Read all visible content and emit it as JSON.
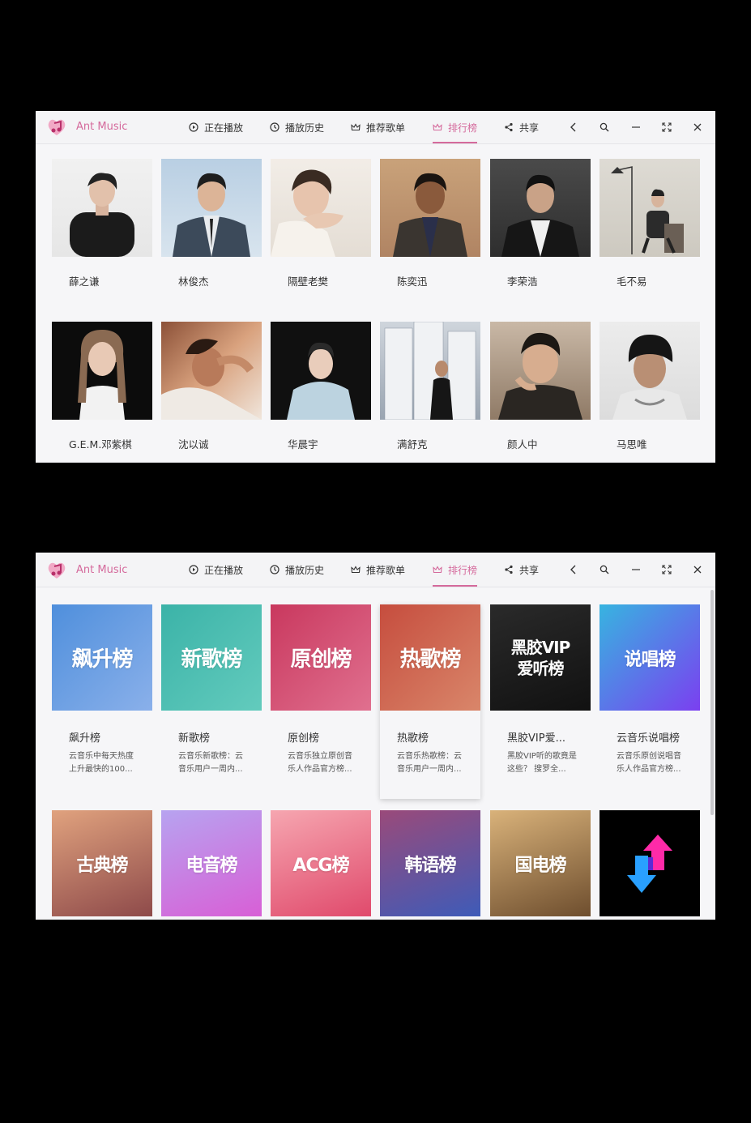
{
  "app": {
    "name": "Ant Music"
  },
  "nav": {
    "now_playing": "正在播放",
    "history": "播放历史",
    "recommended": "推荐歌单",
    "charts": "排行榜",
    "share": "共享"
  },
  "window_controls": [
    "back-icon",
    "search-icon",
    "minimize-icon",
    "maximize-icon",
    "close-icon"
  ],
  "colors": {
    "accent": "#d56a9c",
    "background": "#f6f6f8"
  },
  "artists": [
    {
      "name": "薛之谦"
    },
    {
      "name": "林俊杰"
    },
    {
      "name": "隔壁老樊"
    },
    {
      "name": "陈奕迅"
    },
    {
      "name": "李荣浩"
    },
    {
      "name": "毛不易"
    },
    {
      "name": "G.E.M.邓紫棋"
    },
    {
      "name": "沈以诚"
    },
    {
      "name": "华晨宇"
    },
    {
      "name": "满舒克"
    },
    {
      "name": "颜人中"
    },
    {
      "name": "马思唯"
    }
  ],
  "charts": [
    {
      "name": "飙升榜",
      "desc": "云音乐中每天热度上升最快的100...",
      "cover_text": "飙升榜"
    },
    {
      "name": "新歌榜",
      "desc": "云音乐新歌榜：云音乐用户一周内...",
      "cover_text": "新歌榜"
    },
    {
      "name": "原创榜",
      "desc": "云音乐独立原创音乐人作品官方榜...",
      "cover_text": "原创榜"
    },
    {
      "name": "热歌榜",
      "desc": "云音乐热歌榜：云音乐用户一周内...",
      "cover_text": "热歌榜"
    },
    {
      "name": "黑胶VIP爱...",
      "desc": "黑胶VIP听的歌竟是这些？ 搜罗全...",
      "cover_text": "黑胶VIP 爱听榜"
    },
    {
      "name": "云音乐说唱榜",
      "desc": "云音乐原创说唱音乐人作品官方榜...",
      "cover_text": "说唱榜"
    },
    {
      "cover_text": "古典榜"
    },
    {
      "cover_text": "电音榜"
    },
    {
      "cover_text": "ACG榜"
    },
    {
      "cover_text": "韩语榜"
    },
    {
      "cover_text": "国电榜"
    },
    {
      "cover_text": ""
    }
  ]
}
